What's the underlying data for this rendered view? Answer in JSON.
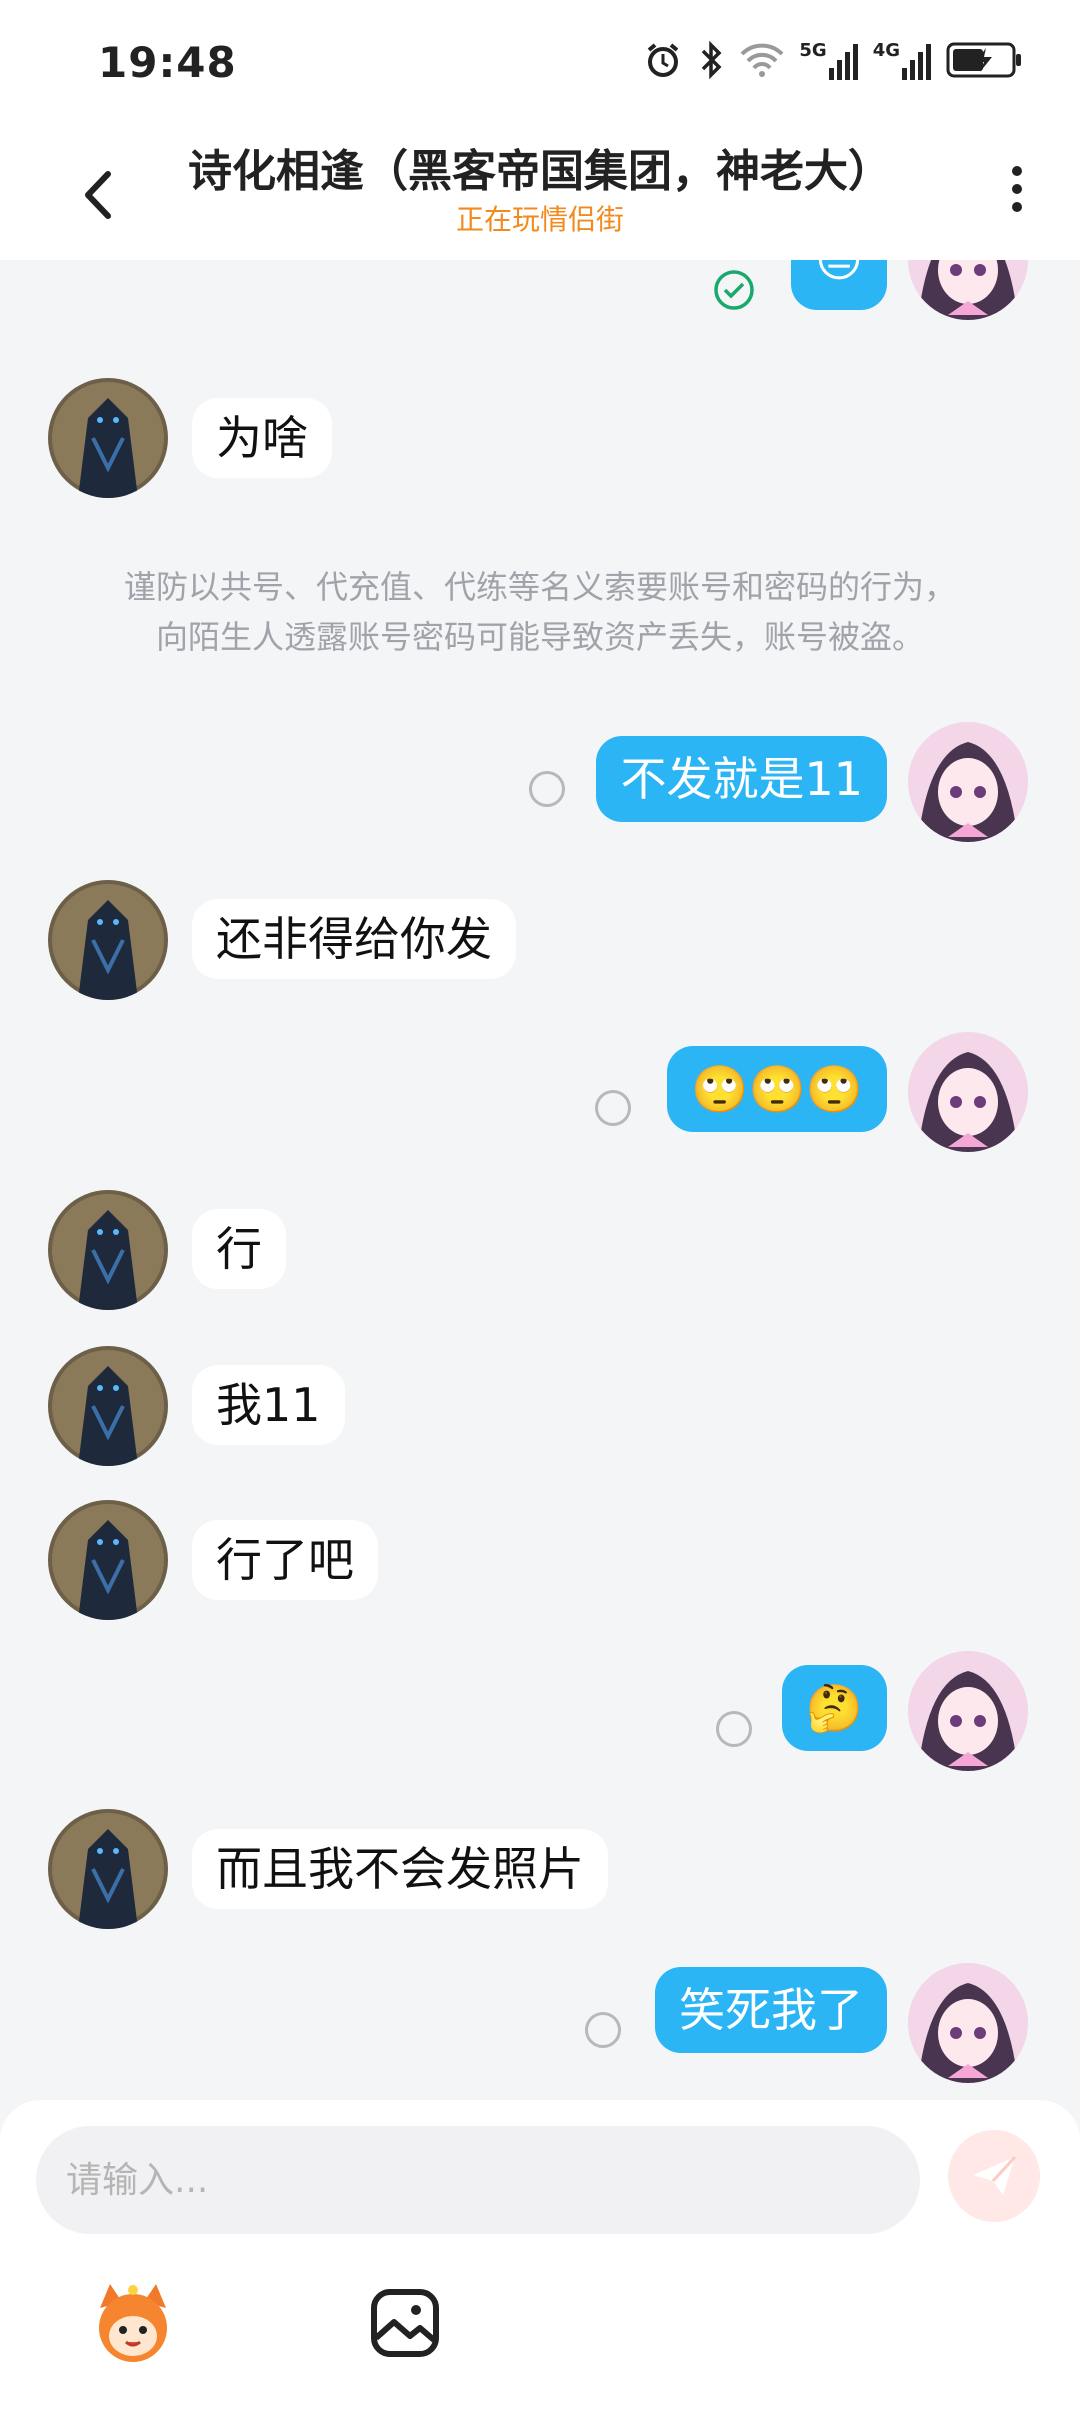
{
  "status_bar": {
    "time": "19:48",
    "network_5g": "5G",
    "network_4g": "4G"
  },
  "header": {
    "title": "诗化相逢（黑客帝国集团，神老大）",
    "subtitle": "正在玩情侣街"
  },
  "messages": [
    {
      "side": "right",
      "kind": "emoji",
      "text": "😐",
      "status": "read"
    },
    {
      "side": "left",
      "text": "为啥"
    },
    {
      "side": "right",
      "text": "不发就是11",
      "status": "sent"
    },
    {
      "side": "left",
      "text": "还非得给你发"
    },
    {
      "side": "right",
      "kind": "emoji",
      "text": "🙄🙄🙄",
      "status": "sent"
    },
    {
      "side": "left",
      "text": "行"
    },
    {
      "side": "left",
      "text": "我11"
    },
    {
      "side": "left",
      "text": "行了吧"
    },
    {
      "side": "right",
      "kind": "emoji",
      "text": "🤔",
      "status": "sent"
    },
    {
      "side": "left",
      "text": "而且我不会发照片"
    },
    {
      "side": "right",
      "text": "笑死我了",
      "status": "sent"
    }
  ],
  "notice": {
    "line1": "谨防以共号、代充值、代练等名义索要账号和密码的行为，",
    "line2": "向陌生人透露账号密码可能导致资产丢失，账号被盗。"
  },
  "input": {
    "placeholder": "请输入..."
  },
  "icons": {
    "back": "back-arrow-icon",
    "more": "more-vertical-icon",
    "send": "send-icon",
    "sticker": "mascot-sticker-icon",
    "image": "image-picker-icon"
  },
  "colors": {
    "accent_bubble": "#2bb5f5",
    "subtitle": "#f28a1d",
    "read_check": "#1aa86b",
    "send_button_bg": "#ffe8e6"
  }
}
